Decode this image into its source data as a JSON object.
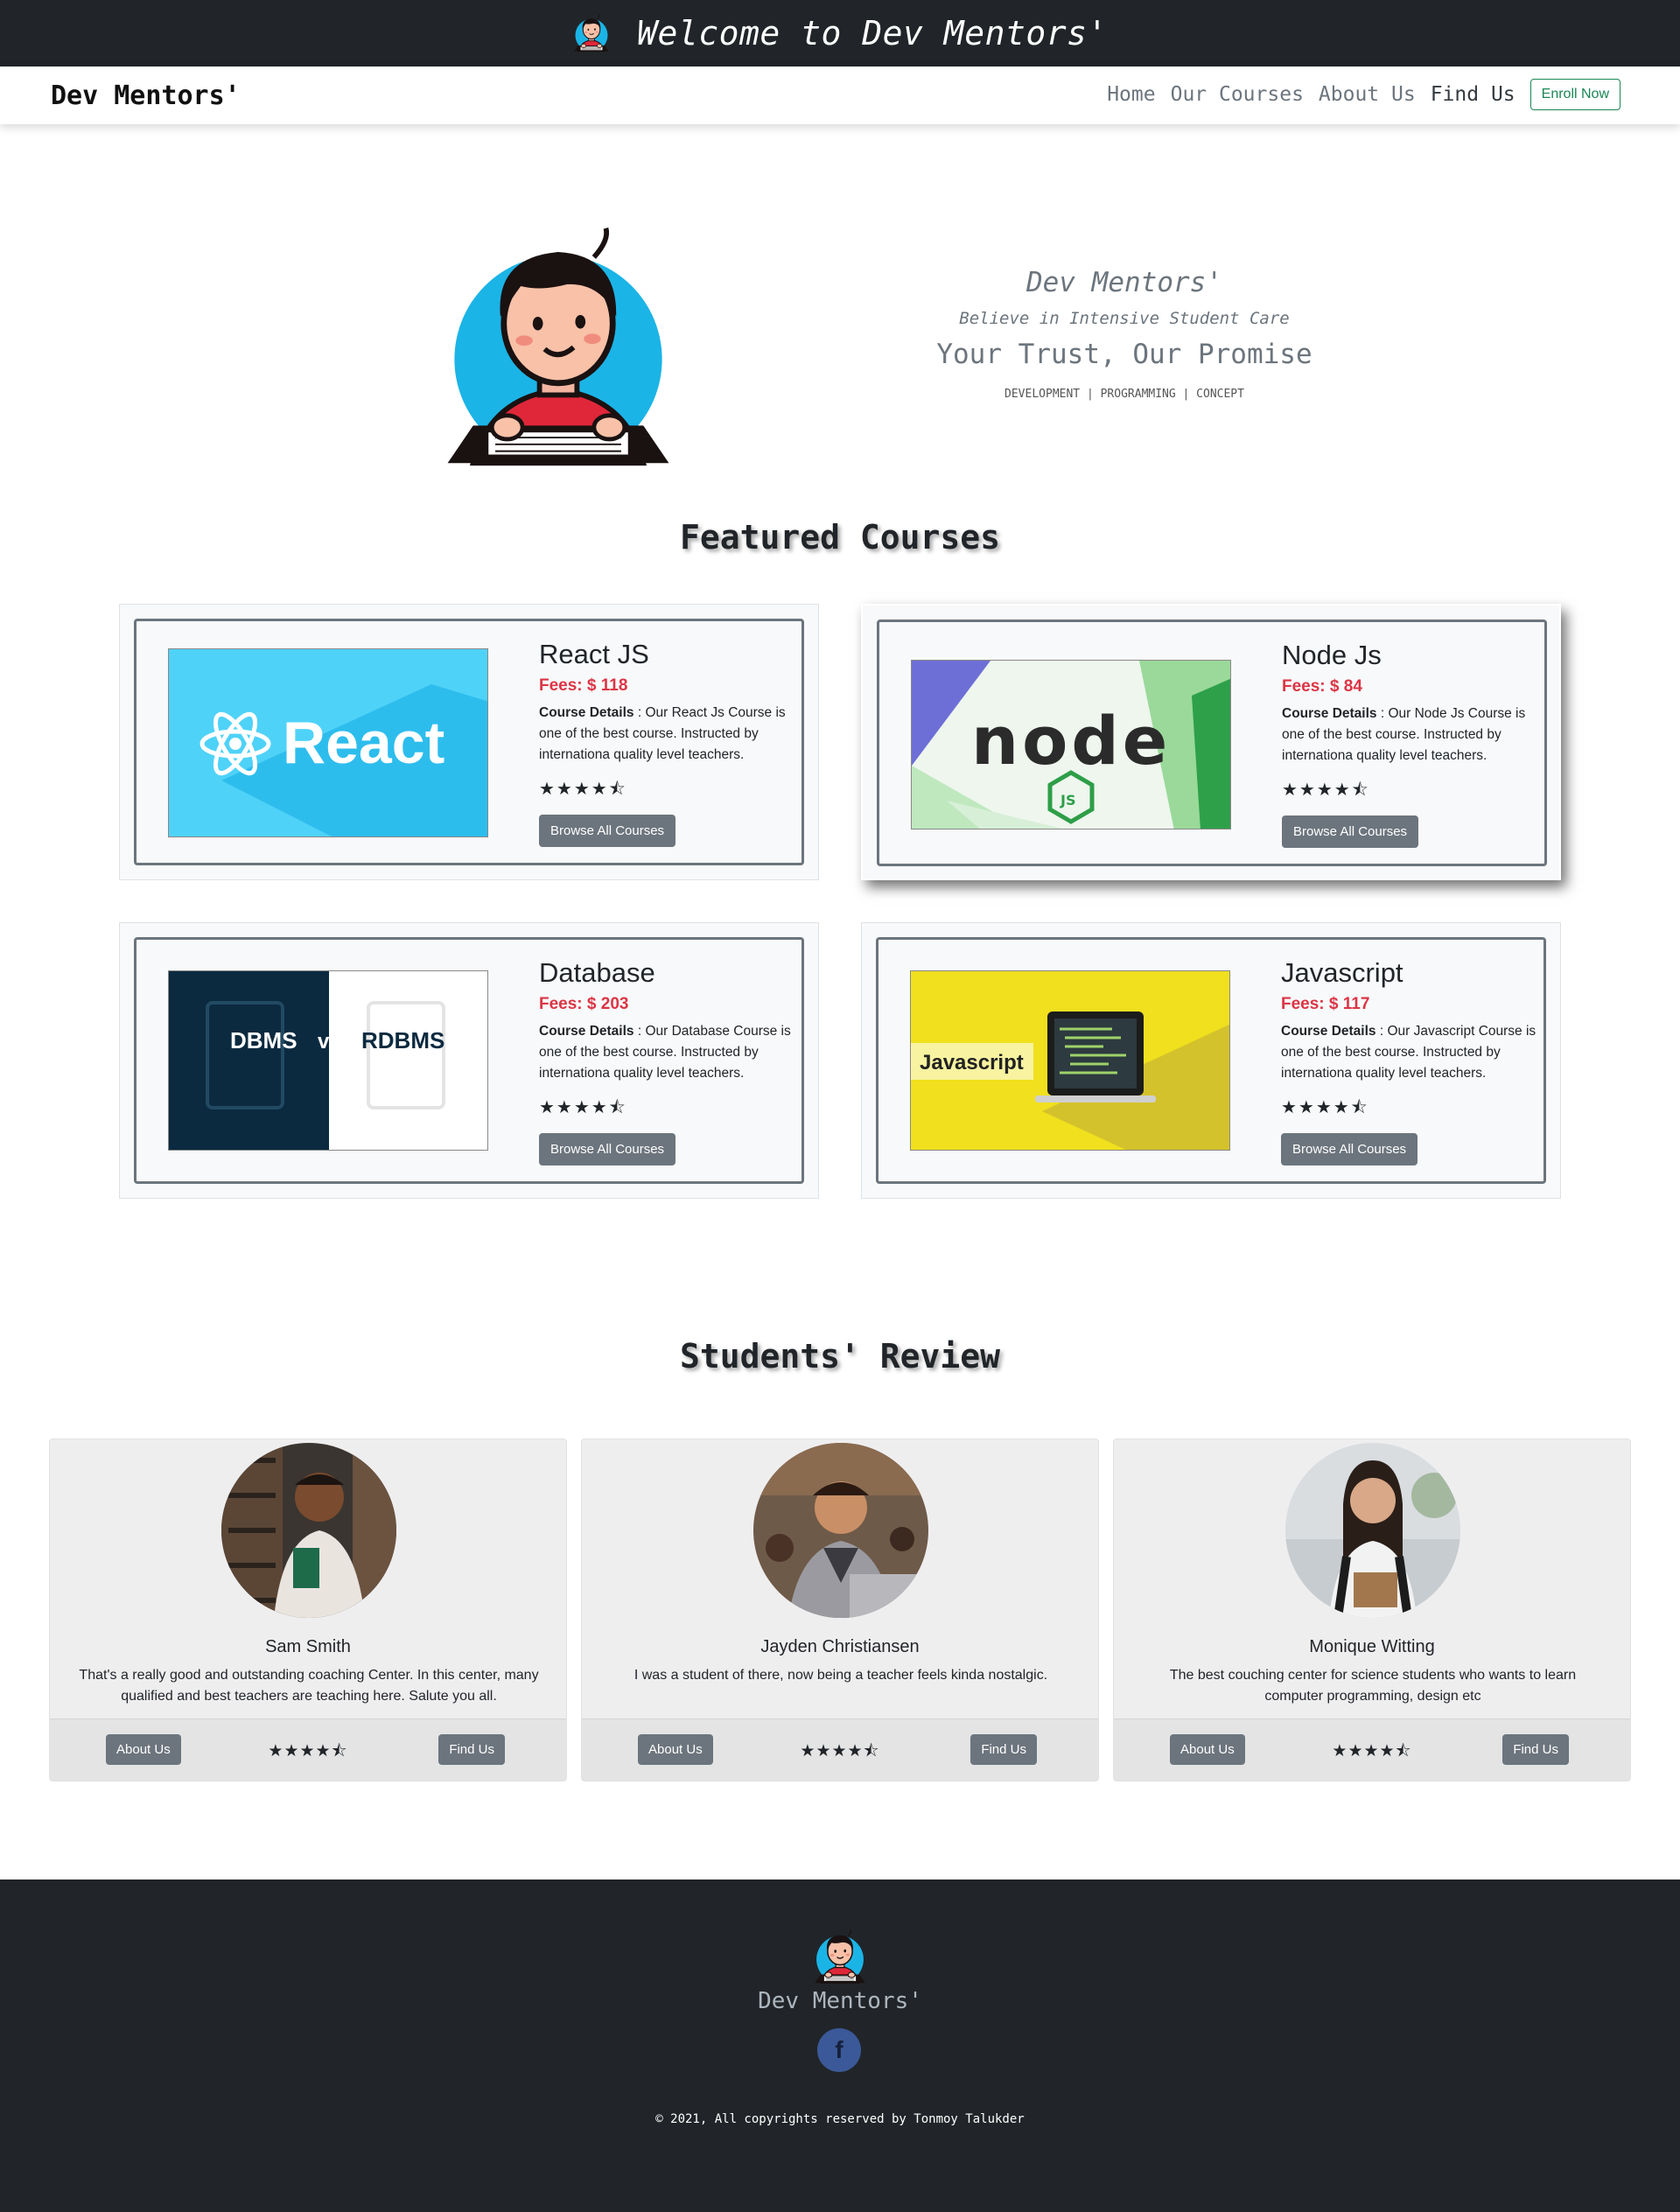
{
  "banner": {
    "title": "Welcome to Dev Mentors'"
  },
  "navbar": {
    "brand": "Dev Mentors'",
    "links": [
      "Home",
      "Our Courses",
      "About Us",
      "Find Us"
    ],
    "enroll_label": "Enroll Now"
  },
  "hero": {
    "title": "Dev Mentors'",
    "tagline": "Believe in Intensive Student Care",
    "promise": "Your Trust, Our Promise",
    "subtitle": "DEVELOPMENT | PROGRAMMING | CONCEPT"
  },
  "featured": {
    "heading": "Featured Courses",
    "courses": [
      {
        "name": "React JS",
        "fees": "Fees: $ 118",
        "details_label": "Course Details",
        "details": " : Our React Js Course is one of the best course. Instructed by internationa quality level teachers.",
        "rating": 4.5,
        "button": "Browse All Courses",
        "image_text": "React"
      },
      {
        "name": "Node Js",
        "fees": "Fees: $ 84",
        "details_label": "Course Details",
        "details": " : Our Node Js Course is one of the best course. Instructed by internationa quality level teachers.",
        "rating": 4.5,
        "button": "Browse All Courses",
        "image_text": "node"
      },
      {
        "name": "Database",
        "fees": "Fees: $ 203",
        "details_label": "Course Details",
        "details": " : Our Database Course is one of the best course. Instructed by internationa quality level teachers.",
        "rating": 4.5,
        "button": "Browse All Courses",
        "image_text_left": "DBMS",
        "image_text_vs": "vs",
        "image_text_right": "RDBMS"
      },
      {
        "name": "Javascript",
        "fees": "Fees: $ 117",
        "details_label": "Course Details",
        "details": " : Our Javascript Course is one of the best course. Instructed by internationa quality level teachers.",
        "rating": 4.5,
        "button": "Browse All Courses",
        "image_text": "Javascript"
      }
    ]
  },
  "reviews": {
    "heading": "Students' Review",
    "items": [
      {
        "name": "Sam Smith",
        "text": "That's a really good and outstanding coaching Center. In this center, many qualified and best teachers are teaching here. Salute you all.",
        "rating": 4.5,
        "about_label": "About Us",
        "find_label": "Find Us"
      },
      {
        "name": "Jayden Christiansen",
        "text": "I was a student of there, now being a teacher feels kinda nostalgic.",
        "rating": 4.5,
        "about_label": "About Us",
        "find_label": "Find Us"
      },
      {
        "name": "Monique Witting",
        "text": "The best couching center for science students who wants to learn computer programming, design etc",
        "rating": 4.5,
        "about_label": "About Us",
        "find_label": "Find Us"
      }
    ]
  },
  "footer": {
    "brand": "Dev Mentors'",
    "social_icon": "f",
    "copyright": "© 2021, All copyrights reserved by Tonmoy Talukder"
  },
  "colors": {
    "dark": "#212529",
    "accent_green": "#198754",
    "fees_red": "#dc3545",
    "button_gray": "#6c757d",
    "facebook": "#3b5998"
  }
}
